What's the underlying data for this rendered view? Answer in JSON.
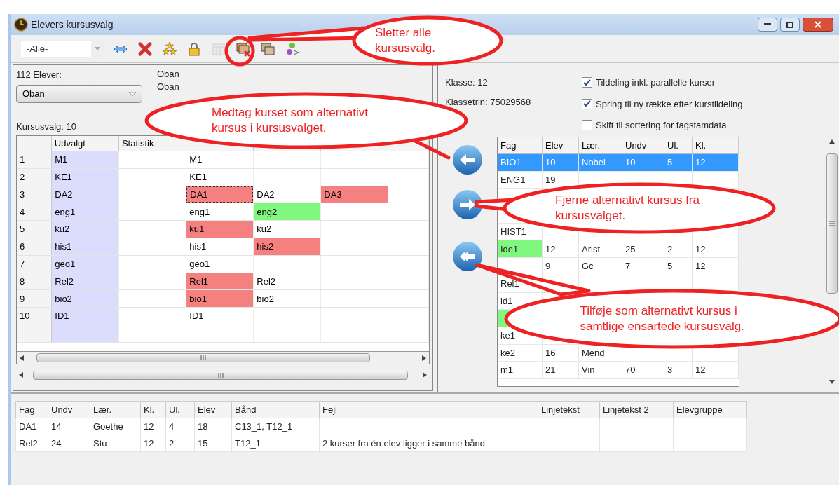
{
  "window": {
    "title": "Elevers kursusvalg"
  },
  "toolbar": {
    "filter": "-Alle-",
    "tools": [
      {
        "kind": "swap",
        "disabled": false
      },
      {
        "kind": "delete",
        "disabled": false
      },
      {
        "kind": "stars",
        "disabled": false
      },
      {
        "kind": "lock",
        "disabled": false
      },
      {
        "kind": "calendar",
        "disabled": true
      },
      {
        "kind": "clear-all",
        "disabled": false
      },
      {
        "kind": "copy",
        "disabled": false
      },
      {
        "kind": "person",
        "disabled": false
      }
    ]
  },
  "left": {
    "count_label": "112 Elever:",
    "student_select": "Oban",
    "name_lines": [
      "Oban",
      "Oban"
    ],
    "choices_label": "Kursusvalg: 10",
    "grid": {
      "columns": [
        "Udvalgt",
        "Statistik"
      ],
      "rows": [
        {
          "number": "1",
          "cells": [
            {
              "text": "M1"
            },
            null,
            {
              "text": "M1"
            },
            null,
            null,
            null
          ]
        },
        {
          "number": "2",
          "cells": [
            {
              "text": "KE1"
            },
            null,
            {
              "text": "KE1"
            },
            null,
            null,
            null
          ]
        },
        {
          "number": "3",
          "cells": [
            {
              "text": "DA2"
            },
            null,
            {
              "text": "DA1",
              "color": "#f48080",
              "focused": true
            },
            {
              "text": "DA2"
            },
            {
              "text": "DA3",
              "color": "#f48080"
            },
            null
          ]
        },
        {
          "number": "4",
          "cells": [
            {
              "text": "eng1"
            },
            null,
            {
              "text": "eng1"
            },
            {
              "text": "eng2",
              "color": "#80f880"
            },
            null,
            null
          ]
        },
        {
          "number": "5",
          "cells": [
            {
              "text": "ku2"
            },
            null,
            {
              "text": "ku1",
              "color": "#f48080"
            },
            {
              "text": "ku2"
            },
            null,
            null
          ]
        },
        {
          "number": "6",
          "cells": [
            {
              "text": "his1"
            },
            null,
            {
              "text": "his1"
            },
            {
              "text": "his2",
              "color": "#f48080"
            },
            null,
            null
          ]
        },
        {
          "number": "7",
          "cells": [
            {
              "text": "geo1"
            },
            null,
            {
              "text": "geo1"
            },
            null,
            null,
            null
          ]
        },
        {
          "number": "8",
          "cells": [
            {
              "text": "Rel2"
            },
            null,
            {
              "text": "Rel1",
              "color": "#f48080"
            },
            {
              "text": "Rel2"
            },
            null,
            null
          ]
        },
        {
          "number": "9",
          "cells": [
            {
              "text": "bio2"
            },
            null,
            {
              "text": "bio1",
              "color": "#f48080"
            },
            {
              "text": "bio2"
            },
            null,
            null
          ]
        },
        {
          "number": "10",
          "cells": [
            {
              "text": "ID1"
            },
            null,
            {
              "text": "ID1"
            },
            null,
            null,
            null
          ]
        }
      ]
    }
  },
  "right": {
    "class_label": "Klasse: 12",
    "level_label": "Klassetrin: 75029568",
    "options": [
      {
        "label": "Tildeling inkl. parallelle kurser",
        "checked": true
      },
      {
        "label": "Spring til ny række efter kurstildeling",
        "checked": true
      },
      {
        "label": "Skift til sortering for fagstamdata",
        "checked": false
      }
    ],
    "courses": {
      "columns": [
        "Fag",
        "Elev",
        "Lær.",
        "Undv",
        "Ul.",
        "Kl."
      ],
      "rows": [
        {
          "selected": true,
          "cells": [
            "BIO1",
            "10",
            "Nobel",
            "10",
            "5",
            "12"
          ]
        },
        {
          "selected": false,
          "cells": [
            "ENG1",
            "19",
            null,
            null,
            null,
            null
          ]
        },
        {
          "selected": false,
          "cells": [
            null,
            null,
            null,
            null,
            null,
            null
          ]
        },
        {
          "selected": false,
          "cells": [
            null,
            null,
            null,
            null,
            null,
            null
          ]
        },
        {
          "selected": false,
          "cells": [
            "HIST1",
            null,
            null,
            null,
            null,
            null
          ]
        },
        {
          "selected": false,
          "color": "#80f880",
          "cells": [
            "Ide1",
            "12",
            "Arist",
            "25",
            "2",
            "12"
          ]
        },
        {
          "selected": false,
          "cells": [
            null,
            "9",
            "Gc",
            "7",
            "5",
            "12"
          ]
        },
        {
          "selected": false,
          "cells": [
            "Rel1",
            null,
            null,
            null,
            null,
            null
          ]
        },
        {
          "selected": false,
          "cells": [
            "id1",
            null,
            null,
            null,
            null,
            null
          ]
        },
        {
          "selected": false,
          "color": "#80f880",
          "cells": [
            null,
            null,
            null,
            null,
            null,
            null
          ]
        },
        {
          "selected": false,
          "cells": [
            "ke1",
            null,
            null,
            null,
            null,
            null
          ]
        },
        {
          "selected": false,
          "cells": [
            "ke2",
            "16",
            "Mend",
            null,
            null,
            null
          ]
        },
        {
          "selected": false,
          "cells": [
            "m1",
            "21",
            "Vin",
            "70",
            "3",
            "12"
          ]
        }
      ]
    }
  },
  "errors": {
    "columns": [
      "Fag",
      "Undv",
      "Lær.",
      "Kl.",
      "Ul.",
      "Elev",
      "Bånd",
      "Fejl",
      "Linjetekst",
      "Linjetekst 2",
      "Elevgruppe"
    ],
    "rows": [
      [
        "DA1",
        "14",
        "Goethe",
        "12",
        "4",
        "18",
        "C13_1, T12_1",
        null,
        null,
        null,
        null
      ],
      [
        "Rel2",
        "24",
        "Stu",
        "12",
        "2",
        "15",
        "T12_1",
        "2 kurser fra én elev ligger i samme bånd",
        null,
        null,
        null
      ]
    ]
  },
  "callouts": [
    {
      "text": "Sletter alle kursusvalg."
    },
    {
      "text": "Medtag kurset som alternativt kursus i kursusvalget."
    },
    {
      "text": "Fjerne alternativt kursus fra kursusvalget."
    },
    {
      "text": "Tilføje som alternativt kursus i samtlige ensartede kursusvalg."
    }
  ]
}
